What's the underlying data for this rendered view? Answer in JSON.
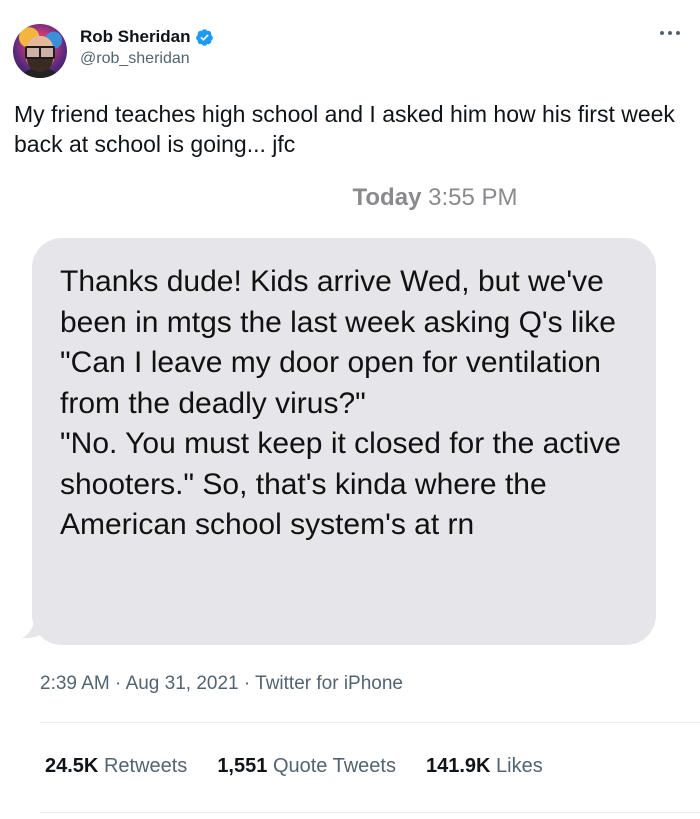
{
  "author": {
    "display_name": "Rob Sheridan",
    "handle": "@rob_sheridan",
    "verified_icon": "verified-badge-icon",
    "verified_color": "#1d9bf0"
  },
  "tweet": {
    "text": "My friend teaches high school and I asked him how his first week back at school is going... jfc"
  },
  "media": {
    "header_day": "Today",
    "header_time": "3:55 PM",
    "message": "Thanks dude! Kids arrive Wed, but we've been in mtgs the last week asking Q's like \"Can I leave my door open for ventilation from the deadly virus?\"\n\"No. You must keep it closed for the active shooters.\" So, that's kinda where the American school system's at rn",
    "bubble_color": "#e5e5ea"
  },
  "meta": {
    "time": "2:39 AM",
    "separator": "·",
    "date": "Aug 31, 2021",
    "source": "Twitter for iPhone"
  },
  "stats": {
    "retweets_count": "24.5K",
    "retweets_label": "Retweets",
    "quotes_count": "1,551",
    "quotes_label": "Quote Tweets",
    "likes_count": "141.9K",
    "likes_label": "Likes"
  }
}
